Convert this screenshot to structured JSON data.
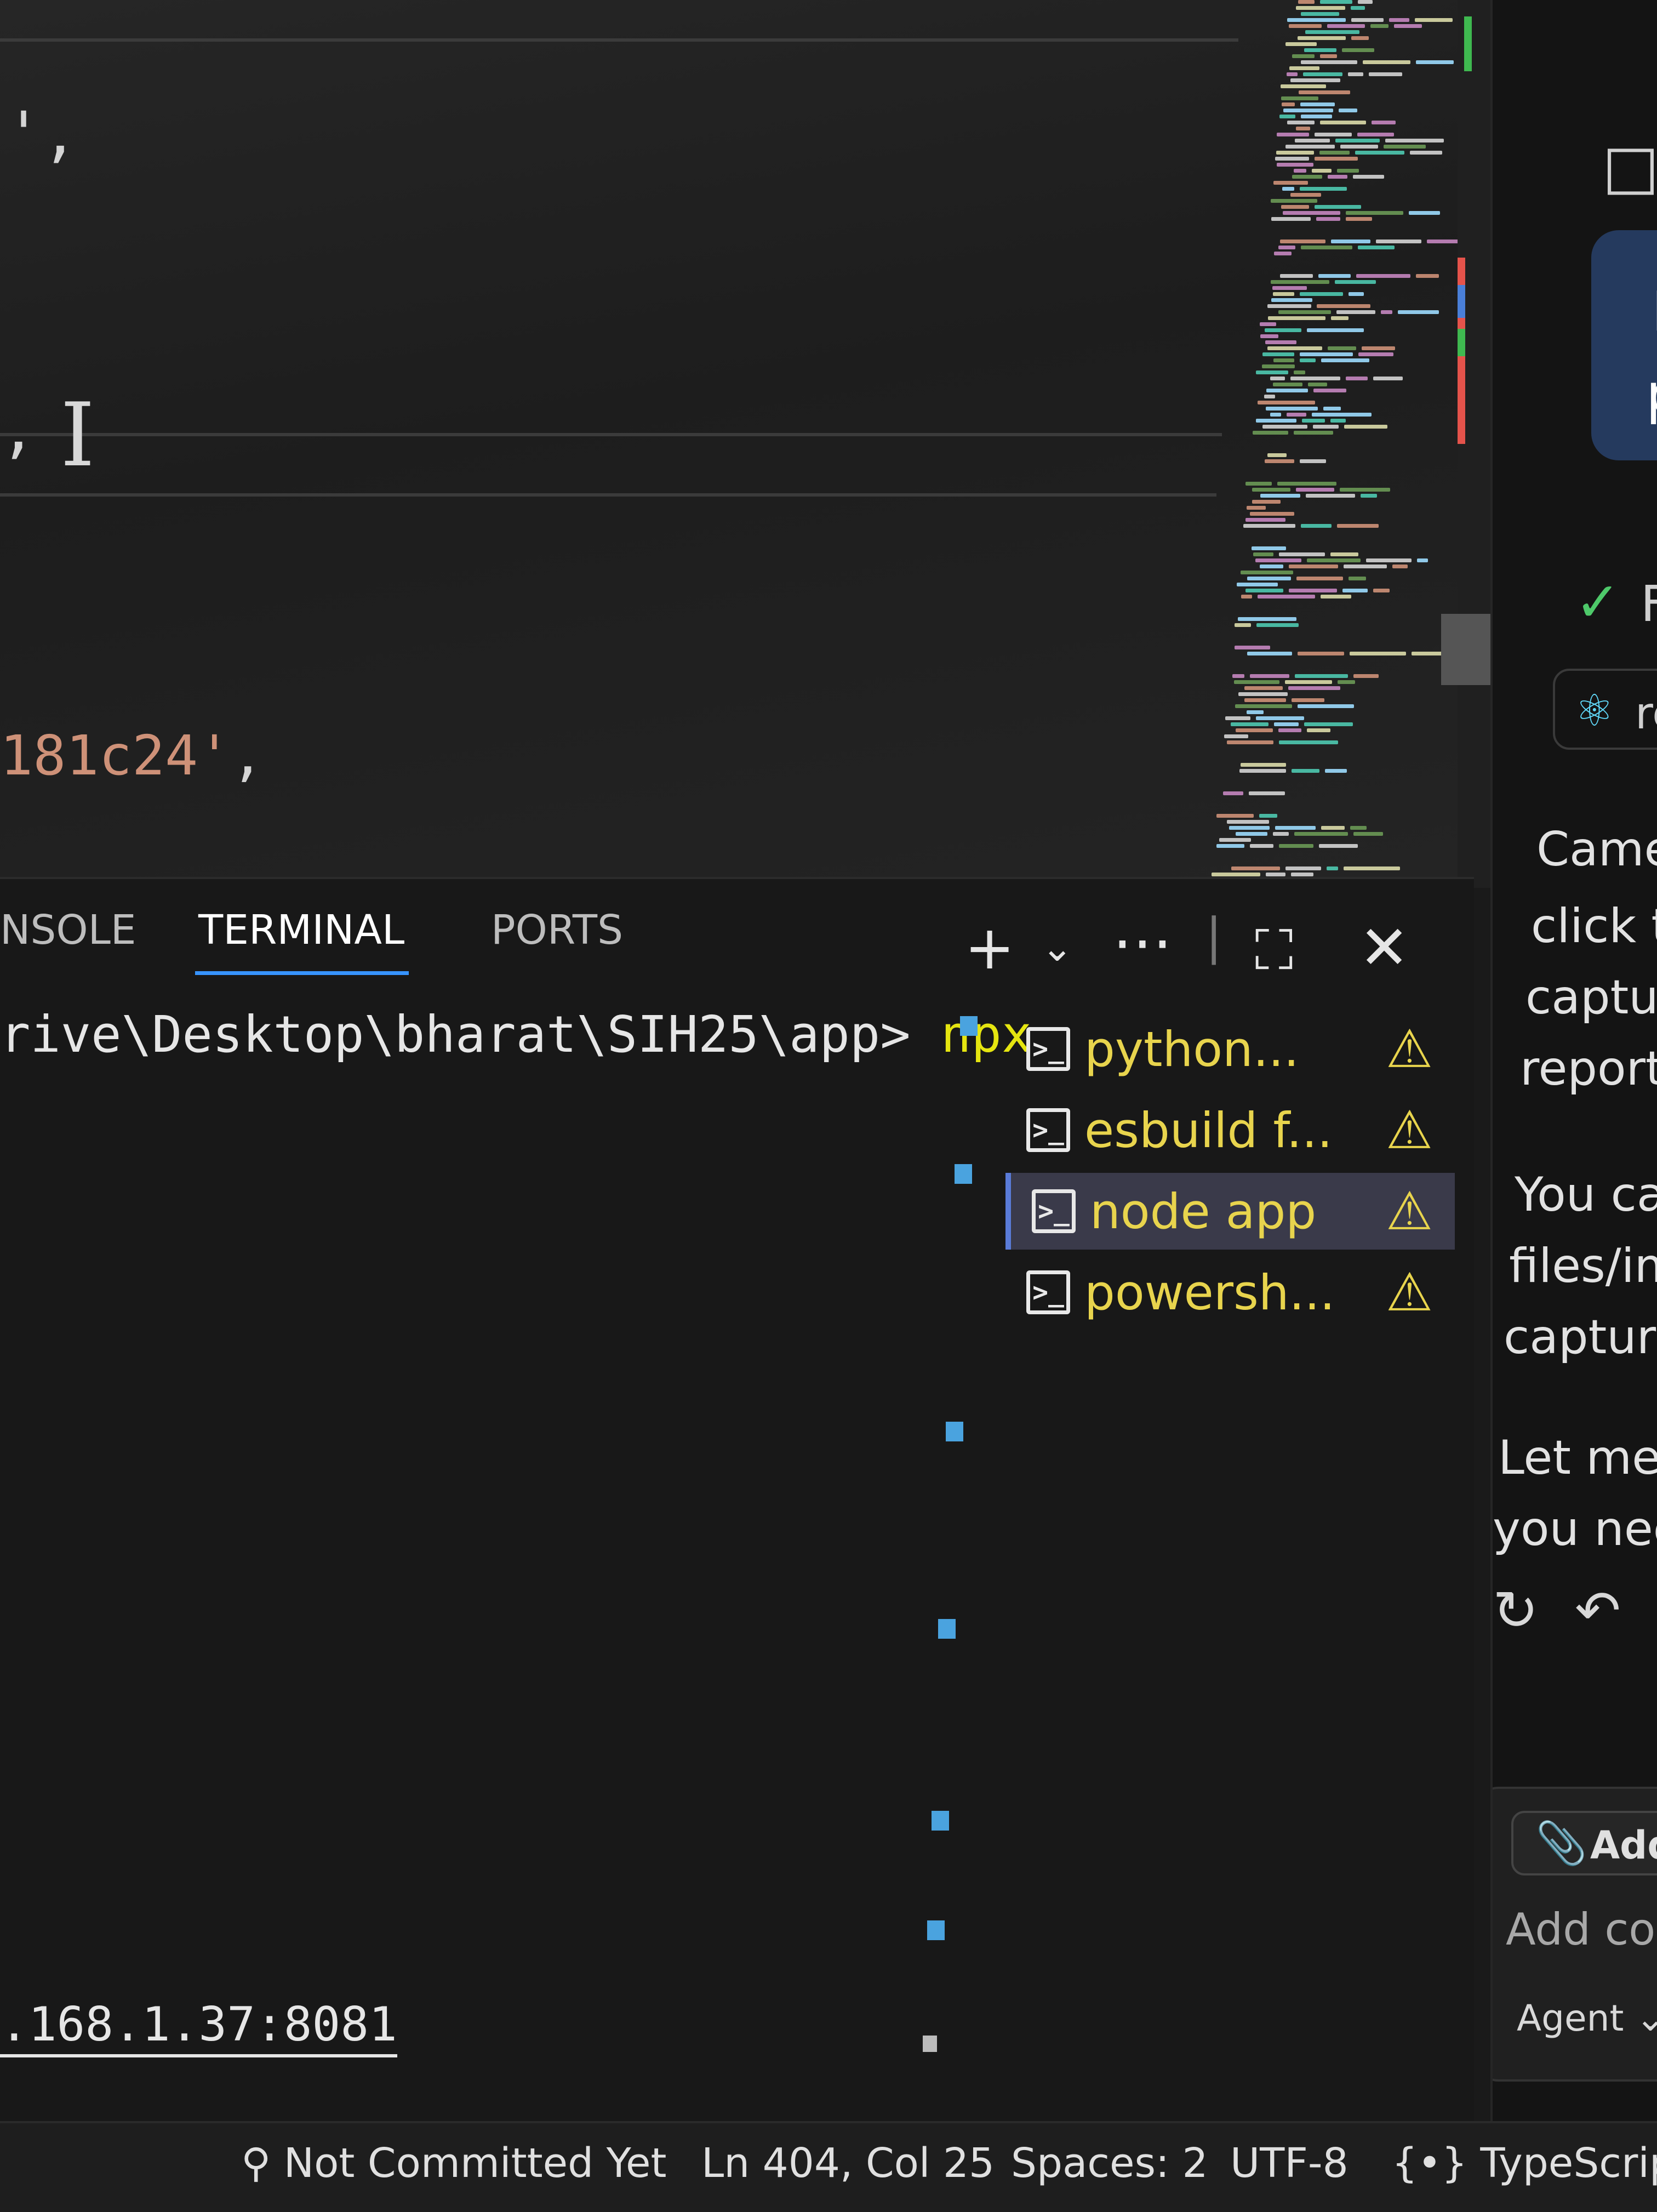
{
  "editor": {
    "line_a": "',",
    "line_b": ",",
    "cursor_glyph": "I",
    "code_string": "181c24'",
    "code_punct": ","
  },
  "panel": {
    "tabs": [
      {
        "label": "NSOLE"
      },
      {
        "label": "TERMINAL"
      },
      {
        "label": "PORTS"
      }
    ],
    "icons": {
      "new_terminal": "plus-icon",
      "dropdown": "chevron-down-icon",
      "more": "ellipsis-icon",
      "maximize": "maximize-icon",
      "close": "close-icon"
    },
    "terminal": {
      "prompt": "rive\\Desktop\\bharat\\SIH25\\app>",
      "command": "npx",
      "address": ".168.1.37:8081"
    },
    "terminals": [
      {
        "name": "python...",
        "icon": "terminal-icon",
        "warning": "warning-icon",
        "active": false
      },
      {
        "name": "esbuild f...",
        "icon": "terminal-icon",
        "warning": "warning-icon",
        "active": false
      },
      {
        "name": "node app",
        "icon": "terminal-icon",
        "warning": "warning-icon",
        "active": true
      },
      {
        "name": "powersh...",
        "icon": "terminal-icon",
        "warning": "warning-icon",
        "active": false
      }
    ]
  },
  "status_bar": {
    "commit": "Not Committed Yet",
    "position": "Ln 404, Col 25",
    "spaces": "Spaces: 2",
    "encoding": "UTF-8",
    "language": "TypeScript J"
  },
  "chat": {
    "bubble_line1": "I",
    "bubble_line2": "p",
    "check_text": "F",
    "ref_chip": "re",
    "para1": [
      "Came",
      "click t",
      "captur",
      "report."
    ],
    "para2": [
      "You can",
      "files/ima",
      "capture)"
    ],
    "para3": [
      "Let me k",
      "you need"
    ],
    "add_context_label": "Add C",
    "input_placeholder": "Add cont",
    "agent_label": "Agent"
  },
  "colors": {
    "accent": "#3794ff",
    "terminal_name": "#e8d44d",
    "string": "#ce9178",
    "command": "#e5e510",
    "check": "#4ec96a"
  }
}
